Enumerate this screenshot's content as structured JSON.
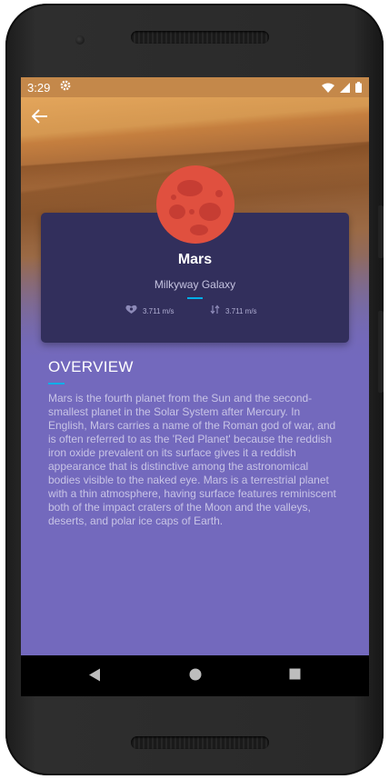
{
  "status_bar": {
    "time": "3:29",
    "settings_icon": "gear-icon",
    "wifi_icon": "wifi-icon",
    "signal_icon": "signal-icon",
    "battery_icon": "battery-icon"
  },
  "header": {
    "back_icon": "arrow-back-icon"
  },
  "planet_card": {
    "name": "Mars",
    "galaxy": "Milkyway Galaxy",
    "stats": [
      {
        "icon": "gravity-icon",
        "value": "3.711 m/s"
      },
      {
        "icon": "arrow-down-icon",
        "value": "3.711 m/s"
      }
    ]
  },
  "overview": {
    "title": "OVERVIEW",
    "text": "Mars is the fourth planet from the Sun and the second-smallest planet in the Solar System after Mercury. In English, Mars carries a name of the Roman god of war, and is often referred to as the 'Red Planet' because the reddish iron oxide prevalent on its surface gives it a reddish appearance that is distinctive among the astronomical bodies visible to the naked eye. Mars is a terrestrial planet with a thin atmosphere, having surface features reminiscent both of the impact craters of the Moon and the valleys, deserts, and polar ice caps of Earth."
  },
  "nav_bar": {
    "back_icon": "nav-back-icon",
    "home_icon": "nav-home-icon",
    "recents_icon": "nav-recents-icon"
  },
  "colors": {
    "background": "#7369bd",
    "card": "#322f5c",
    "accent": "#00aee8",
    "planet": "#e0503f"
  }
}
